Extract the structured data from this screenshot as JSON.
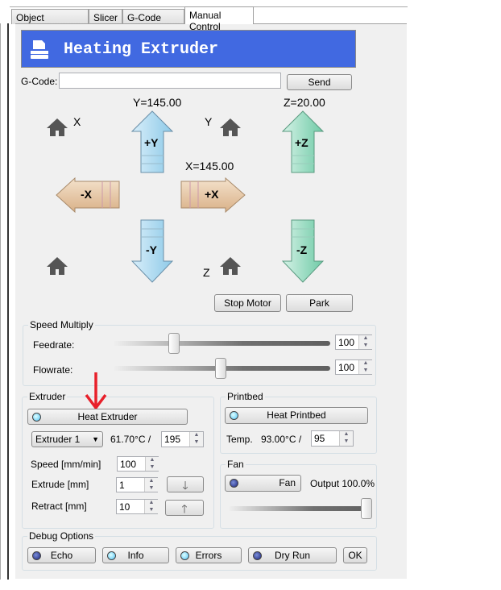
{
  "tabs": [
    {
      "label": "Object Placement"
    },
    {
      "label": "Slicer"
    },
    {
      "label": "G-Code Editor"
    },
    {
      "label": "Manual Control",
      "active": true
    }
  ],
  "header": {
    "title": "Heating Extruder",
    "icon": "printer-icon",
    "color": "#4169e1"
  },
  "gcode": {
    "label": "G-Code:",
    "value": "",
    "send": "Send"
  },
  "axes": {
    "y_pos": "Y=145.00",
    "x_pos": "X=145.00",
    "z_pos": "Z=20.00",
    "home_x": "X",
    "home_y": "Y",
    "home_z": "Z",
    "plus_y": "+Y",
    "minus_y": "-Y",
    "plus_x": "+X",
    "minus_x": "-X",
    "plus_z": "+Z",
    "minus_z": "-Z"
  },
  "motor": {
    "stop": "Stop Motor",
    "park": "Park"
  },
  "speed": {
    "title": "Speed Multiply",
    "feedrate_label": "Feedrate:",
    "feedrate": "100",
    "flowrate_label": "Flowrate:",
    "flowrate": "100"
  },
  "extruder": {
    "title": "Extruder",
    "heat_btn": "Heat Extruder",
    "select": "Extruder 1",
    "temp": "61.70°C /",
    "target": "195",
    "speed_label": "Speed [mm/min]",
    "speed": "100",
    "extrude_label": "Extrude [mm]",
    "extrude": "1",
    "retract_label": "Retract [mm]",
    "retract": "10"
  },
  "printbed": {
    "title": "Printbed",
    "heat_btn": "Heat Printbed",
    "temp_label": "Temp.",
    "temp": "93.00°C /",
    "target": "95"
  },
  "fan": {
    "title": "Fan",
    "btn": "Fan",
    "output": "Output 100.0%",
    "level_percent": 100
  },
  "debug": {
    "title": "Debug Options",
    "echo": "Echo",
    "info": "Info",
    "errors": "Errors",
    "dry_run": "Dry Run",
    "ok": "OK"
  }
}
